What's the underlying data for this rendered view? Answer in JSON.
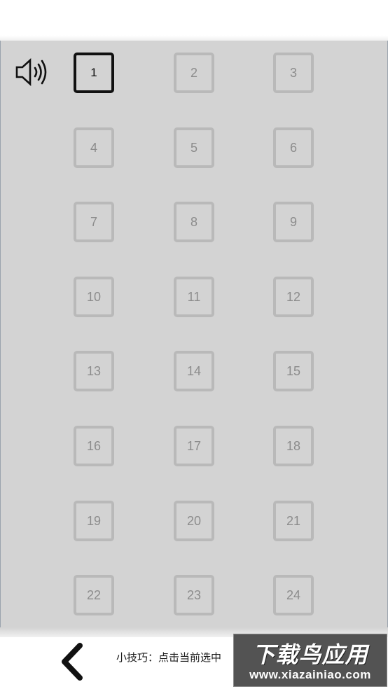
{
  "sound": {
    "icon": "speaker-on-icon"
  },
  "levels": [
    {
      "label": "1",
      "state": "unlocked"
    },
    {
      "label": "2",
      "state": "locked"
    },
    {
      "label": "3",
      "state": "locked"
    },
    {
      "label": "4",
      "state": "locked"
    },
    {
      "label": "5",
      "state": "locked"
    },
    {
      "label": "6",
      "state": "locked"
    },
    {
      "label": "7",
      "state": "locked"
    },
    {
      "label": "8",
      "state": "locked"
    },
    {
      "label": "9",
      "state": "locked"
    },
    {
      "label": "10",
      "state": "locked"
    },
    {
      "label": "11",
      "state": "locked"
    },
    {
      "label": "12",
      "state": "locked"
    },
    {
      "label": "13",
      "state": "locked"
    },
    {
      "label": "14",
      "state": "locked"
    },
    {
      "label": "15",
      "state": "locked"
    },
    {
      "label": "16",
      "state": "locked"
    },
    {
      "label": "17",
      "state": "locked"
    },
    {
      "label": "18",
      "state": "locked"
    },
    {
      "label": "19",
      "state": "locked"
    },
    {
      "label": "20",
      "state": "locked"
    },
    {
      "label": "21",
      "state": "locked"
    },
    {
      "label": "22",
      "state": "locked"
    },
    {
      "label": "23",
      "state": "locked"
    },
    {
      "label": "24",
      "state": "locked"
    }
  ],
  "footer": {
    "back_icon": "chevron-left-icon",
    "tip": "小技巧：点击当前选中"
  },
  "watermark": {
    "title": "下载鸟应用",
    "url": "www.xiazainiao.com"
  },
  "colors": {
    "background": "#d3d3d3",
    "locked_border": "#b9b9b9",
    "locked_text": "#8c8c8c",
    "unlocked_border": "#111111"
  }
}
